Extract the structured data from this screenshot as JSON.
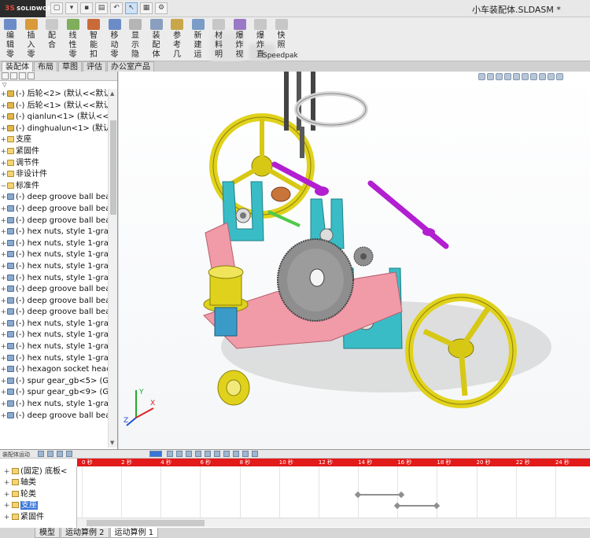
{
  "app": {
    "logo_text": "SOLIDWORKS",
    "logo_mark": "3S",
    "document_title": "小车装配体.SLDASM *"
  },
  "quick_access": [
    {
      "icon": "new-doc-icon",
      "glyph": "▢"
    },
    {
      "icon": "open-icon",
      "glyph": "▾"
    },
    {
      "icon": "save-icon",
      "glyph": "▪"
    },
    {
      "icon": "print-icon",
      "glyph": "▤"
    },
    {
      "icon": "undo-icon",
      "glyph": "↶"
    },
    {
      "icon": "select-icon",
      "glyph": "↖"
    },
    {
      "icon": "rebuild-icon",
      "glyph": "▦"
    },
    {
      "icon": "options-icon",
      "glyph": "⚙"
    }
  ],
  "command_manager": {
    "commands": [
      {
        "label": "编辑零",
        "color": "#6b8cc7"
      },
      {
        "label": "插入零",
        "color": "#d99a3a"
      },
      {
        "label": "配合",
        "color": "#c9c9c9"
      },
      {
        "label": "线性零",
        "color": "#7fae5c"
      },
      {
        "label": "智能扣",
        "color": "#c96a3a"
      },
      {
        "label": "移动零",
        "color": "#6b8cc7"
      },
      {
        "label": "显示隐",
        "color": "#b5b5b5"
      },
      {
        "label": "装配体",
        "color": "#8a9fbf"
      },
      {
        "label": "参考几",
        "color": "#c9a64a"
      },
      {
        "label": "新建运",
        "color": "#7a9cc6"
      },
      {
        "label": "材料明",
        "color": "#c7c7c7"
      },
      {
        "label": "爆炸视",
        "color": "#9a7ac6"
      },
      {
        "label": "爆炸直",
        "color": "#c7c7c7"
      },
      {
        "label": "快照",
        "color": "#c7c7c7"
      }
    ],
    "speedpak_label": "Speedpak"
  },
  "command_tabs": [
    "装配体",
    "布局",
    "草图",
    "评估",
    "办公室产品"
  ],
  "feature_manager": {
    "filter_glyph": "▽",
    "tree": [
      {
        "type": "part",
        "label": "(-) 后轮<2> (默认<<默认"
      },
      {
        "type": "part",
        "label": "(-) 后轮<1> (默认<<默认"
      },
      {
        "type": "part",
        "label": "(-) qianlun<1> (默认<<默"
      },
      {
        "type": "part",
        "label": "(-) dinghualun<1> (默认"
      },
      {
        "type": "folder",
        "label": "支座"
      },
      {
        "type": "folder",
        "label": "紧固件"
      },
      {
        "type": "folder",
        "label": "调节件"
      },
      {
        "type": "folder",
        "label": "非设计件"
      },
      {
        "type": "folder",
        "label": "标准件",
        "expanded": true
      },
      {
        "type": "comp",
        "label": "(-) deep groove ball bea"
      },
      {
        "type": "comp",
        "label": "(-) deep groove ball bea"
      },
      {
        "type": "comp",
        "label": "(-) deep groove ball bea"
      },
      {
        "type": "comp",
        "label": "(-) hex nuts, style 1-grad"
      },
      {
        "type": "comp",
        "label": "(-) hex nuts, style 1-grac"
      },
      {
        "type": "comp",
        "label": "(-) hex nuts, style 1-grac"
      },
      {
        "type": "comp",
        "label": "(-) hex nuts, style 1-grac"
      },
      {
        "type": "comp",
        "label": "(-) hex nuts, style 1-grac"
      },
      {
        "type": "comp",
        "label": "(-) deep groove ball bea"
      },
      {
        "type": "comp",
        "label": "(-) deep groove ball bea"
      },
      {
        "type": "comp",
        "label": "(-) deep groove ball bea"
      },
      {
        "type": "comp",
        "label": "(-) hex nuts, style 1-grac"
      },
      {
        "type": "comp",
        "label": "(-) hex nuts, style 1-grac"
      },
      {
        "type": "comp",
        "label": "(-) hex nuts, style 1-grac"
      },
      {
        "type": "comp",
        "label": "(-) hex nuts, style 1-grac"
      },
      {
        "type": "comp",
        "label": "(-) hexagon socket heac"
      },
      {
        "type": "comp",
        "label": "(-) spur gear_gb<5> (GE"
      },
      {
        "type": "comp",
        "label": "(-) spur gear_gb<9> (GE"
      },
      {
        "type": "comp",
        "label": "(-) hex nuts, style 1-grac"
      },
      {
        "type": "comp",
        "label": "(-) deep groove ball bea"
      }
    ]
  },
  "triad": {
    "x": "X",
    "y": "Y",
    "z": "Z"
  },
  "motion_manager": {
    "toolbar_label": "装配体运动",
    "timescale": [
      "0 秒",
      "2 秒",
      "4 秒",
      "6 秒",
      "8 秒",
      "10 秒",
      "12 秒",
      "14 秒",
      "16 秒",
      "18 秒",
      "20 秒",
      "22 秒",
      "24 秒"
    ],
    "tree": [
      {
        "label": "(固定) 底板<",
        "selected": false
      },
      {
        "label": "轴类",
        "selected": false
      },
      {
        "label": "轮类",
        "selected": false
      },
      {
        "label": "支座",
        "selected": true
      },
      {
        "label": "紧固件",
        "selected": false
      }
    ],
    "keyframes": [
      {
        "row": 2,
        "start_s": 14.0,
        "end_s": 16.2
      },
      {
        "row": 3,
        "start_s": 16.0,
        "end_s": 18.0
      }
    ],
    "timescale_max_s": 26
  },
  "bottom_tabs": [
    "模型",
    "运动算例 2",
    "运动算例 1"
  ],
  "bottom_tab_active": 2,
  "colors": {
    "motion_scale_bar": "#e21a1a",
    "selection": "#3875d7",
    "wheel_yellow": "#e0d21c",
    "bracket_cyan": "#39bcc6",
    "plate_pink": "#f19aa8",
    "shaft_magenta": "#b21fd0"
  }
}
